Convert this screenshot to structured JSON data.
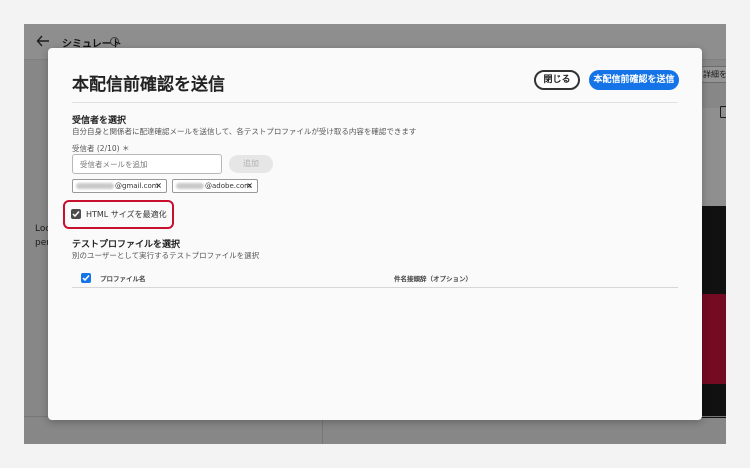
{
  "app": {
    "title": "シミュレート",
    "left_text_1": "Loc",
    "left_text_2": "per",
    "right_button": "詳細を"
  },
  "dialog": {
    "title": "本配信前確認を送信",
    "close_label": "閉じる",
    "send_label": "本配信前確認を送信",
    "recipients": {
      "heading": "受信者を選択",
      "description": "自分自身と関係者に配達確認メールを送信して、各テストプロファイルが受け取る内容を確認できます",
      "field_label": "受信者 (2/10) ＊",
      "input_placeholder": "受信者メールを追加",
      "add_label": "追加",
      "tags": [
        {
          "domain": "@gmail.com"
        },
        {
          "domain": "@adobe.com"
        }
      ]
    },
    "optimize_html": {
      "label": "HTML サイズを最適化",
      "checked": true
    },
    "profiles": {
      "heading": "テストプロファイルを選択",
      "description": "別のユーザーとして実行するテストプロファイルを選択",
      "col_name": "プロファイル名",
      "col_subject": "件名接頭辞（オプション）"
    }
  },
  "colors": {
    "accent": "#1473e6",
    "highlight": "#c8102e"
  }
}
